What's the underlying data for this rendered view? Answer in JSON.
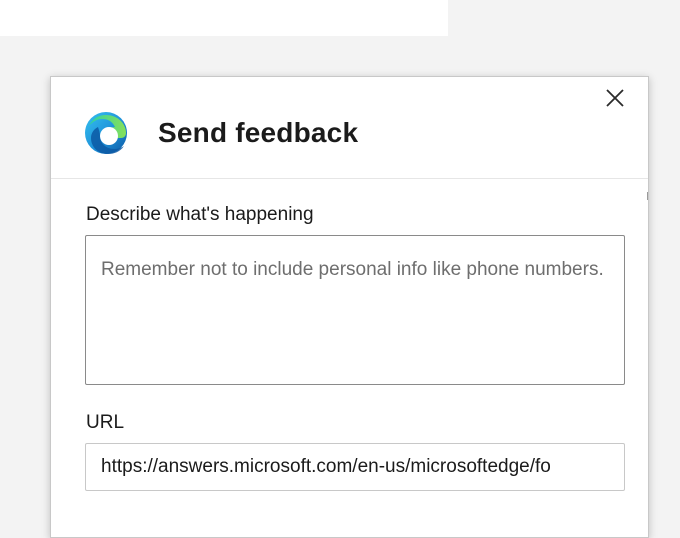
{
  "dialog": {
    "title": "Send feedback",
    "logo_icon": "microsoft-edge-logo-icon",
    "close_icon": "close-icon"
  },
  "describe": {
    "label": "Describe what's happening",
    "placeholder": "Remember not to include personal info like phone numbers.",
    "value": ""
  },
  "url": {
    "label": "URL",
    "value": "https://answers.microsoft.com/en-us/microsoftedge/fo"
  },
  "colors": {
    "background": "#f3f3f3",
    "dialog_bg": "#ffffff",
    "text": "#1b1b1b",
    "placeholder": "#6e6e6e",
    "edge_blue": "#0c59a4",
    "edge_green": "#48c45a"
  }
}
